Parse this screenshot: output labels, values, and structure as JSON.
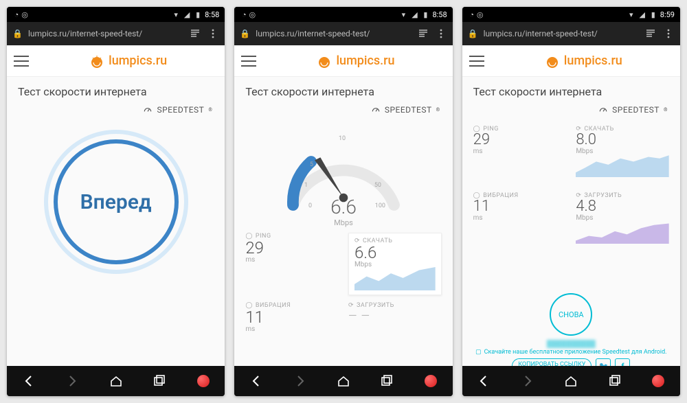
{
  "status_time_a": "8:58",
  "status_time_b": "8:58",
  "status_time_c": "8:59",
  "url": "lumpics.ru/internet-speed-test/",
  "site_name": "lumpics.ru",
  "page_title": "Тест скорости интернета",
  "brand": "SPEEDTEST",
  "trademark": "®",
  "go_label": "Вперед",
  "gauge": {
    "value": "6.6",
    "unit": "Mbps",
    "ticks": {
      "t0": "0",
      "t1": "1",
      "t5": "5",
      "t10": "10",
      "t50": "50",
      "t100": "100"
    }
  },
  "labels": {
    "ping": "PING",
    "jitter": "ВИБРАЦИЯ",
    "download": "СКАЧАТЬ",
    "upload": "ЗАГРУЗИТЬ",
    "ms": "ms",
    "mbps": "Mbps"
  },
  "mid": {
    "ping": "29",
    "jitter": "11",
    "dl": "6.6"
  },
  "res": {
    "ping": "29",
    "jitter": "11",
    "dl": "8.0",
    "ul": "4.8"
  },
  "again": "СНОВА",
  "promo": "Скачайте наше бесплатное приложение Speedtest для Android.",
  "copy": "КОПИРОВАТЬ ССЫЛКУ",
  "fb": "f",
  "tw": "t",
  "dashes": "— —"
}
